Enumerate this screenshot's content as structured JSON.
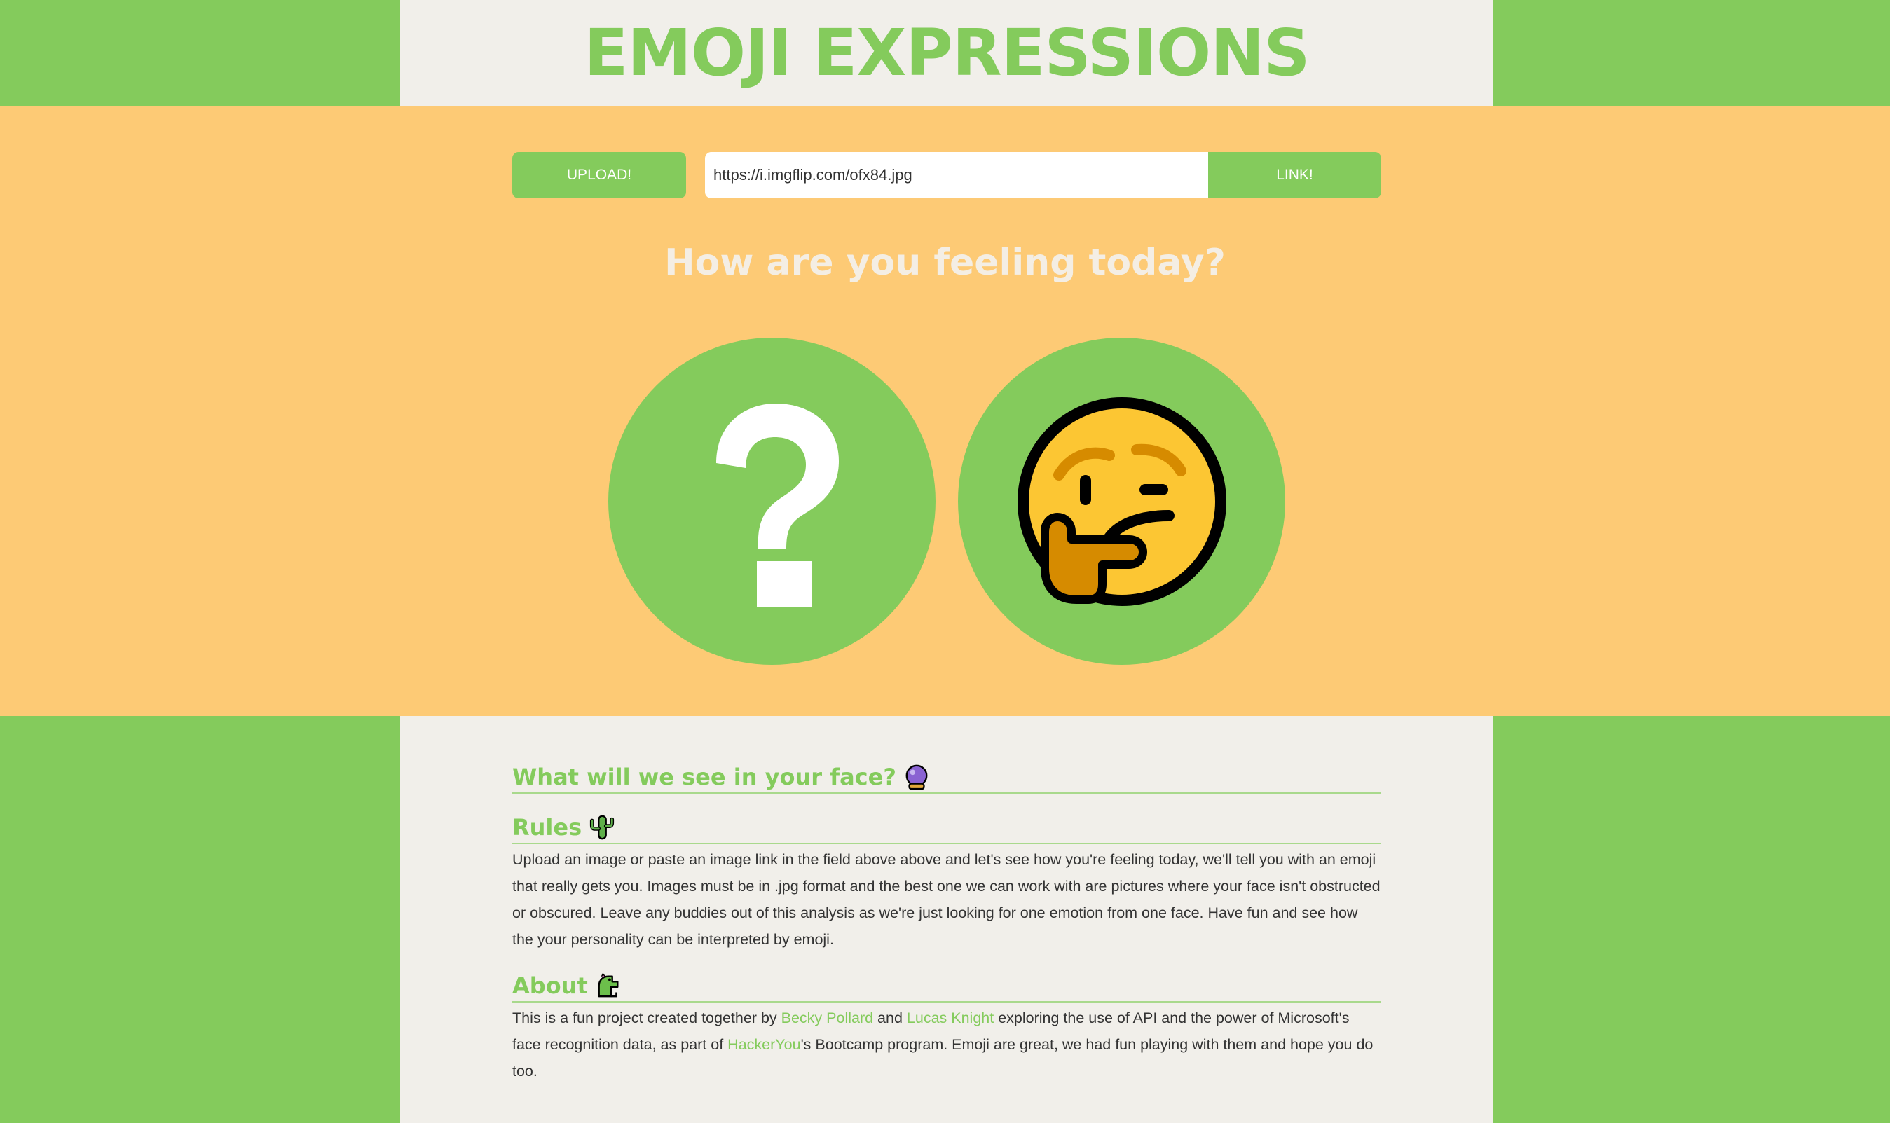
{
  "header": {
    "title": "EMOJI EXPRESSIONS"
  },
  "controls": {
    "upload_label": "UPLOAD!",
    "url_value": "https://i.imgflip.com/ofx84.jpg",
    "link_label": "LINK!"
  },
  "hero": {
    "question": "How are you feeling today?",
    "left_icon": "question-mark-icon",
    "right_icon": "thinking-face-emoji"
  },
  "sections": {
    "see_face": {
      "title": "What will we see in your face?",
      "icon": "crystal-ball-icon"
    },
    "rules": {
      "title": "Rules",
      "icon": "cactus-icon",
      "body": "Upload an image or paste an image link in the field above above and let's see how you're feeling today, we'll tell you with an emoji that really gets you. Images must be in .jpg format and the best one we can work with are pictures where your face isn't obstructed or obscured. Leave any buddies out of this analysis as we're just looking for one emotion from one face. Have fun and see how the your personality can be interpreted by emoji."
    },
    "about": {
      "title": "About",
      "icon": "dragon-icon",
      "text1": "This is a fun project created together by ",
      "link1": "Becky Pollard",
      "text2": " and ",
      "link2": "Lucas Knight",
      "text3": " exploring the use of API and the power of Microsoft's face recognition data, as part of ",
      "link3": "HackerYou",
      "text4": "'s Bootcamp program. Emoji are great, we had fun playing with them and hope you do too."
    }
  },
  "colors": {
    "green": "#84cb5c",
    "orange": "#fdca75",
    "cream": "#f1efea",
    "text": "#333333"
  }
}
